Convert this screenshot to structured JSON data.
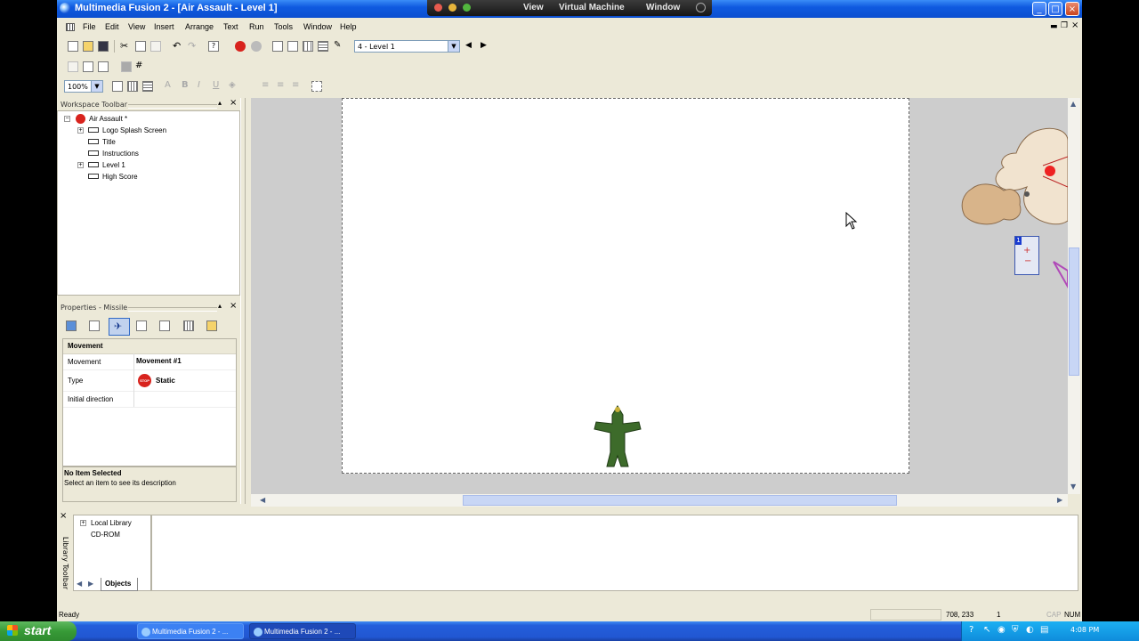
{
  "window": {
    "title": "Multimedia Fusion 2 - [Air Assault - Level 1]",
    "min": "_",
    "max": "□",
    "close": "×"
  },
  "vm_bar": {
    "items": [
      "View",
      "Virtual Machine",
      "Window"
    ]
  },
  "menu": [
    "File",
    "Edit",
    "View",
    "Insert",
    "Arrange",
    "Text",
    "Run",
    "Tools",
    "Window",
    "Help"
  ],
  "toolbar": {
    "frame_select": "4 - Level 1",
    "zoom": "100%"
  },
  "workspace": {
    "header": "Workspace Toolbar",
    "root": "Air Assault *",
    "frames": [
      "Logo Splash Screen",
      "Title",
      "Instructions",
      "Level 1",
      "High Score"
    ]
  },
  "properties": {
    "header": "Properties - Missile",
    "section": "Movement",
    "rows": [
      {
        "label": "Movement",
        "value": "Movement #1"
      },
      {
        "label": "Type",
        "value": "Static",
        "badge": "STOP"
      },
      {
        "label": "Initial direction",
        "value": ""
      }
    ],
    "desc_title": "No Item Selected",
    "desc_text": "Select an item to see its description"
  },
  "library": {
    "vertical_label": "Library Toolbar",
    "items": [
      "Local Library",
      "CD-ROM"
    ],
    "tab": "Objects"
  },
  "status": {
    "left": "Ready",
    "coords": "708, 233",
    "num": "1",
    "caps": "CAP",
    "numlock": "NUM"
  },
  "taskbar": {
    "start": "start",
    "tasks": [
      "Multimedia Fusion 2 - ...",
      "Multimedia Fusion 2 - ..."
    ],
    "clock": "4:08 PM"
  },
  "colors": {
    "titlebar": "#0f5ae0",
    "panel": "#ece9d8",
    "stage": "#ffffff"
  }
}
